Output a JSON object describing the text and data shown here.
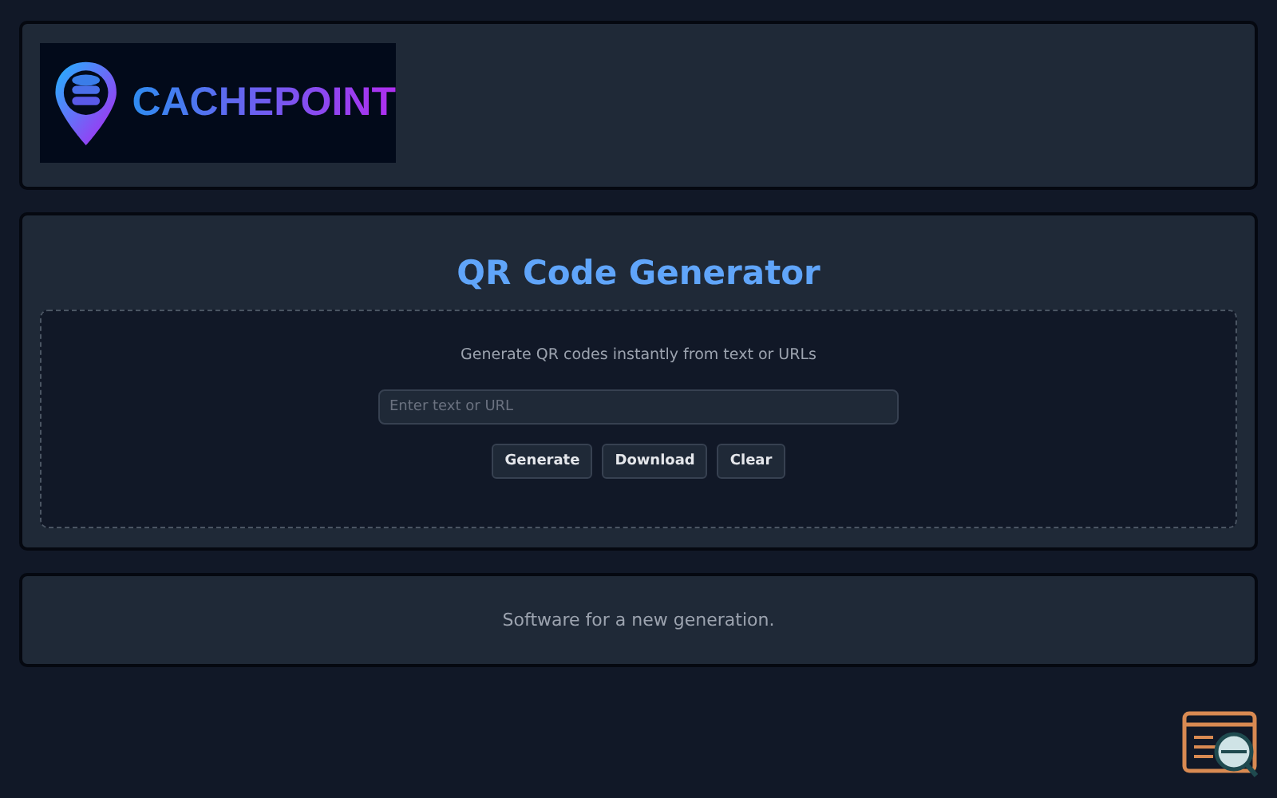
{
  "header": {
    "logo": {
      "text": "CACHEPOINT"
    }
  },
  "main": {
    "title": "QR Code Generator",
    "subtitle": "Generate QR codes instantly from text or URLs",
    "input": {
      "placeholder": "Enter text or URL"
    },
    "buttons": [
      "Generate",
      "Download",
      "Clear"
    ]
  },
  "footer": {
    "text": "Software for a new generation."
  }
}
